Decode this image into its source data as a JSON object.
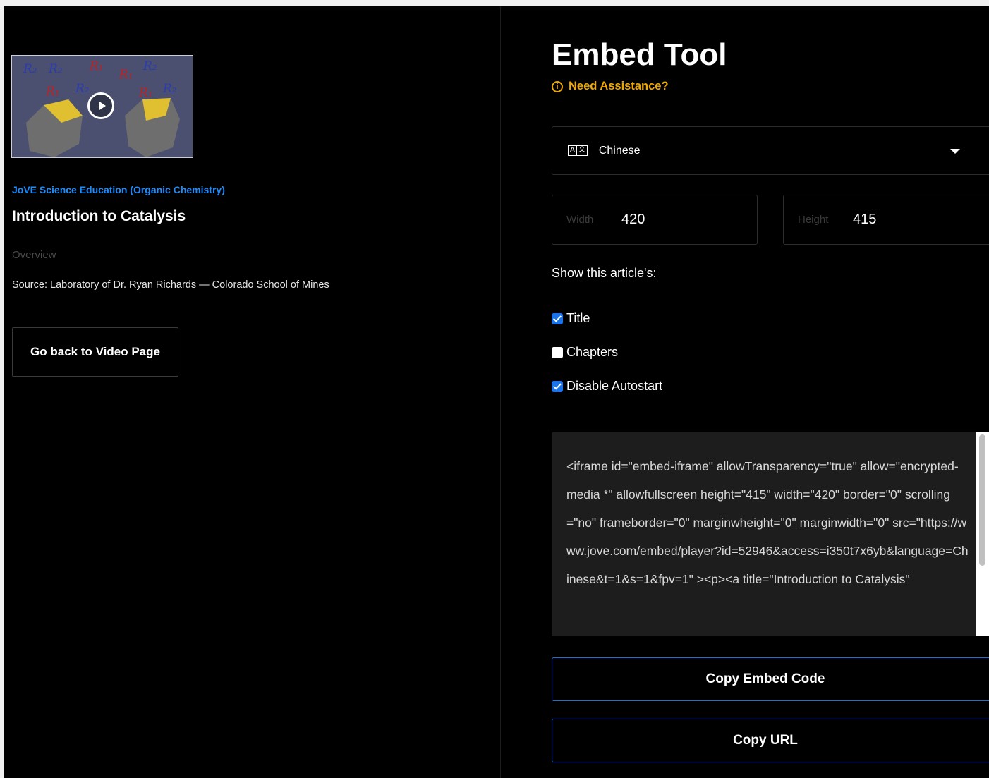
{
  "left": {
    "source_link": "JoVE Science Education (Organic Chemistry)",
    "video_title": "Introduction to Catalysis",
    "overview_label": "Overview",
    "source_text": "Source: Laboratory of Dr. Ryan Richards — Colorado School of Mines",
    "back_button": "Go back to Video Page"
  },
  "right": {
    "title": "Embed Tool",
    "assistance": "Need Assistance?",
    "language": {
      "icon_left": "A",
      "icon_right": "文",
      "selected": "Chinese"
    },
    "width": {
      "label": "Width",
      "value": "420"
    },
    "height": {
      "label": "Height",
      "value": "415"
    },
    "show_label": "Show this article's:",
    "options": [
      {
        "label": "Title",
        "checked": true
      },
      {
        "label": "Chapters",
        "checked": false
      },
      {
        "label": "Disable Autostart",
        "checked": true
      }
    ],
    "embed_code": "<iframe id=\"embed-iframe\" allowTransparency=\"true\" allow=\"encrypted-media *\" allowfullscreen height=\"415\" width=\"420\" border=\"0\" scrolling=\"no\" frameborder=\"0\" marginwheight=\"0\" marginwidth=\"0\" src=\"https://www.jove.com/embed/player?id=52946&access=i350t7x6yb&language=Chinese&t=1&s=1&fpv=1\" ><p><a title=\"Introduction to Catalysis\"",
    "copy_embed": "Copy Embed Code",
    "copy_url": "Copy URL"
  },
  "colors": {
    "link": "#1c8cff",
    "accent": "#f0a800",
    "button_border": "#1c6fd8",
    "checkbox": "#1a73e8"
  }
}
